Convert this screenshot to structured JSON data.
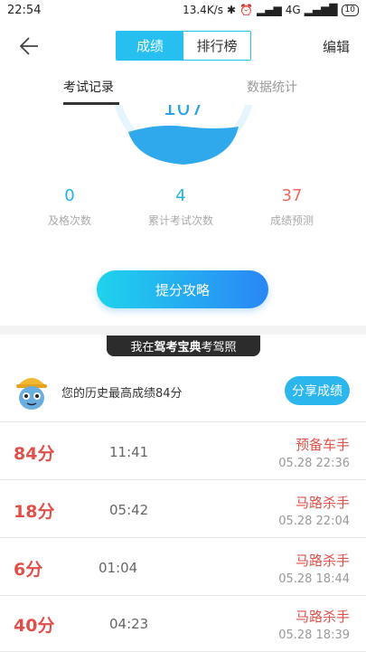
{
  "status_bar": {
    "time": "22:54",
    "speed": "13.4K/s",
    "network": "4G",
    "battery": "10"
  },
  "header": {
    "back_icon": "arrow-left-icon",
    "tabs": [
      {
        "label": "成绩",
        "active": true
      },
      {
        "label": "排行榜",
        "active": false
      }
    ],
    "edit_label": "编辑",
    "accent": "#26bff0"
  },
  "subtabs": [
    {
      "label": "考试记录",
      "active": true
    },
    {
      "label": "数据统计",
      "active": false
    }
  ],
  "gauge": {
    "value_text": "107"
  },
  "stats": [
    {
      "value": "0",
      "label": "及格次数"
    },
    {
      "value": "4",
      "label": "累计考试次数"
    },
    {
      "value": "37",
      "label": "成绩预测"
    }
  ],
  "tip_button": "提分攻略",
  "ribbon": {
    "prefix": "我在",
    "brand": "驾考宝典",
    "suffix": "考驾照"
  },
  "best": {
    "text": "您的历史最高成绩84分",
    "share_label": "分享成绩"
  },
  "records": [
    {
      "score": "84分",
      "duration": "11:41",
      "title": "预备车手",
      "datetime": "05.28  22:36"
    },
    {
      "score": "18分",
      "duration": "05:42",
      "title": "马路杀手",
      "datetime": "05.28  22:04"
    },
    {
      "score": "6分",
      "duration": "01:04",
      "title": "马路杀手",
      "datetime": "05.28  18:44"
    },
    {
      "score": "40分",
      "duration": "04:23",
      "title": "马路杀手",
      "datetime": "05.28  18:39"
    }
  ]
}
